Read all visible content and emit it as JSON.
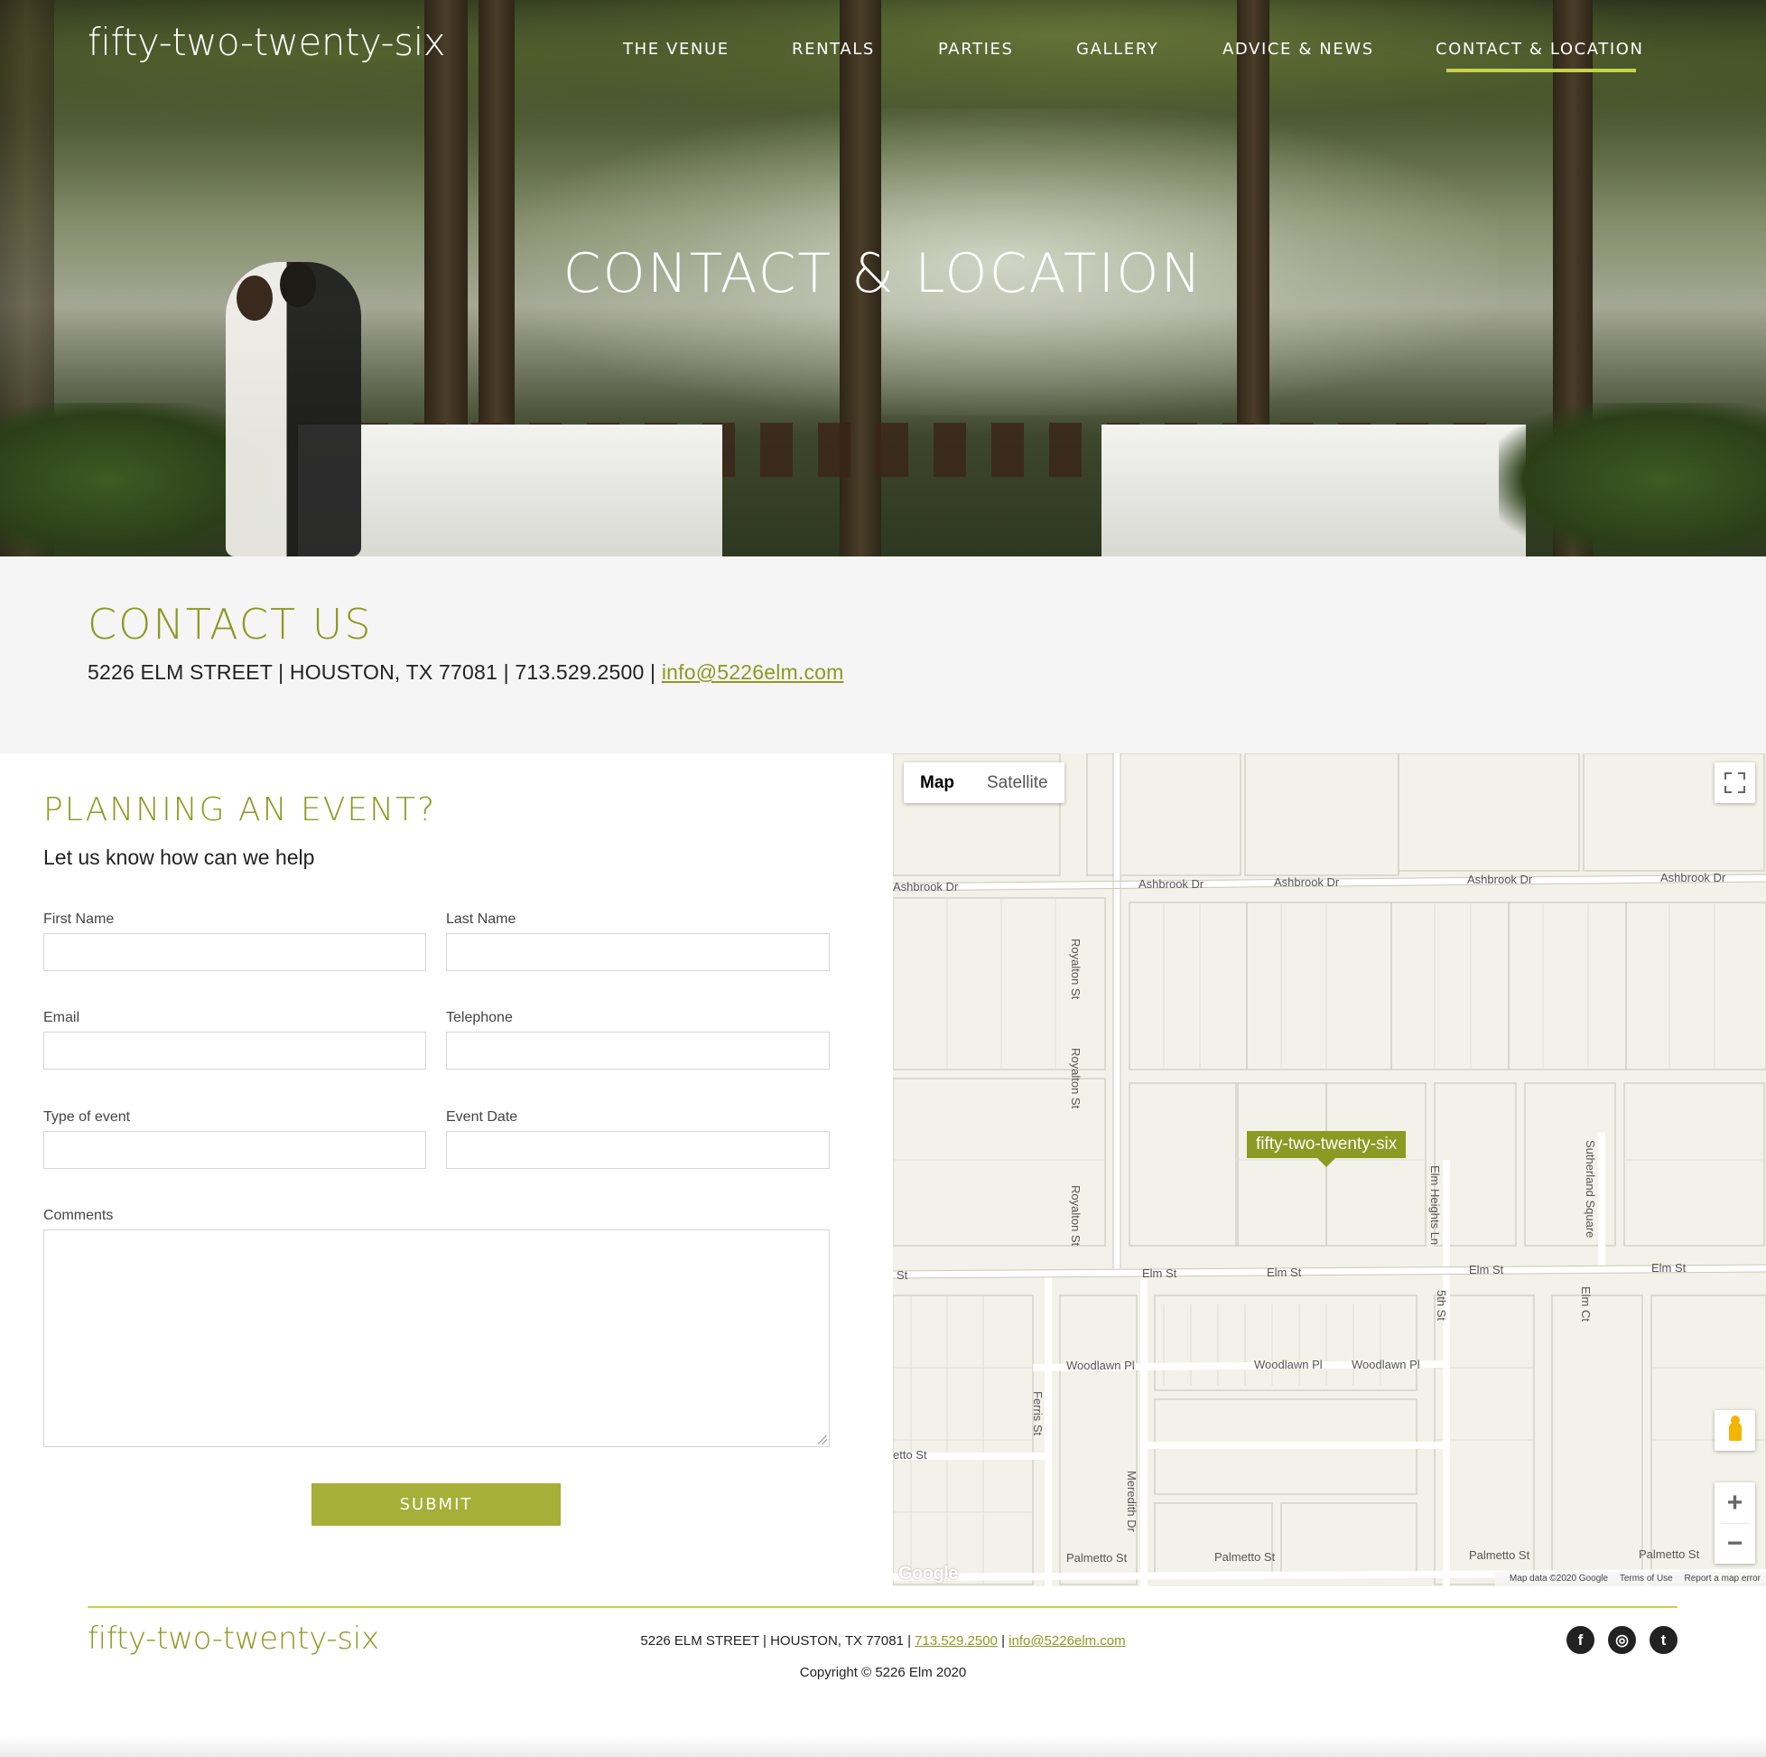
{
  "site": {
    "logo": "fifty-two-twenty-six"
  },
  "nav": {
    "items": [
      {
        "label": "THE VENUE"
      },
      {
        "label": "RENTALS"
      },
      {
        "label": "PARTIES"
      },
      {
        "label": "GALLERY"
      },
      {
        "label": "ADVICE & NEWS"
      },
      {
        "label": "CONTACT & LOCATION",
        "active": true
      }
    ]
  },
  "hero": {
    "title": "CONTACT & LOCATION"
  },
  "contact": {
    "title": "CONTACT US",
    "address": "5226 ELM STREET | HOUSTON, TX 77081 | 713.529.2500 | ",
    "email": "info@5226elm.com"
  },
  "form": {
    "title": "PLANNING AN EVENT?",
    "subtitle": "Let us know how can we help",
    "fields": {
      "first_name": {
        "label": "First Name",
        "value": ""
      },
      "last_name": {
        "label": "Last Name",
        "value": ""
      },
      "email": {
        "label": "Email",
        "value": ""
      },
      "telephone": {
        "label": "Telephone",
        "value": ""
      },
      "event_type": {
        "label": "Type of event",
        "value": ""
      },
      "event_date": {
        "label": "Event Date",
        "value": ""
      },
      "comments": {
        "label": "Comments",
        "value": ""
      }
    },
    "submit_label": "SUBMIT"
  },
  "map": {
    "toggle_map": "Map",
    "toggle_satellite": "Satellite",
    "marker_label": "fifty-two-twenty-six",
    "google_logo": "Google",
    "credits": {
      "data": "Map data ©2020 Google",
      "terms": "Terms of Use",
      "report": "Report a map error"
    },
    "zoom_in": "+",
    "zoom_out": "−",
    "streets": {
      "ashbrook": "Ashbrook Dr",
      "royalton": "Royalton St",
      "elm": "Elm St",
      "elm_heights": "Elm Heights Ln",
      "sutherland": "Sutherland Square",
      "fifth": "5th St",
      "elm_ct": "Elm Ct",
      "woodlawn": "Woodlawn Pl",
      "ferris": "Ferris St",
      "meredith": "Meredith Dr",
      "palmetto": "Palmetto St",
      "st_fragment": "St",
      "etto_fragment": "etto St",
      "ashbrook_fragment": "Ashbrook Dr"
    }
  },
  "footer": {
    "logo": "fifty-two-twenty-six",
    "address": "5226 ELM STREET | HOUSTON, TX 77081 | ",
    "phone": "713.529.2500",
    "sep": " | ",
    "email": "info@5226elm.com",
    "copyright": "Copyright © 5226 Elm 2020",
    "social": [
      {
        "icon": "facebook-icon",
        "glyph": "f"
      },
      {
        "icon": "instagram-icon",
        "glyph": "◎"
      },
      {
        "icon": "twitter-icon",
        "glyph": "t"
      }
    ]
  },
  "colors": {
    "accent": "#8b9a22",
    "button": "#a6af38",
    "underline": "#c6d34a"
  }
}
